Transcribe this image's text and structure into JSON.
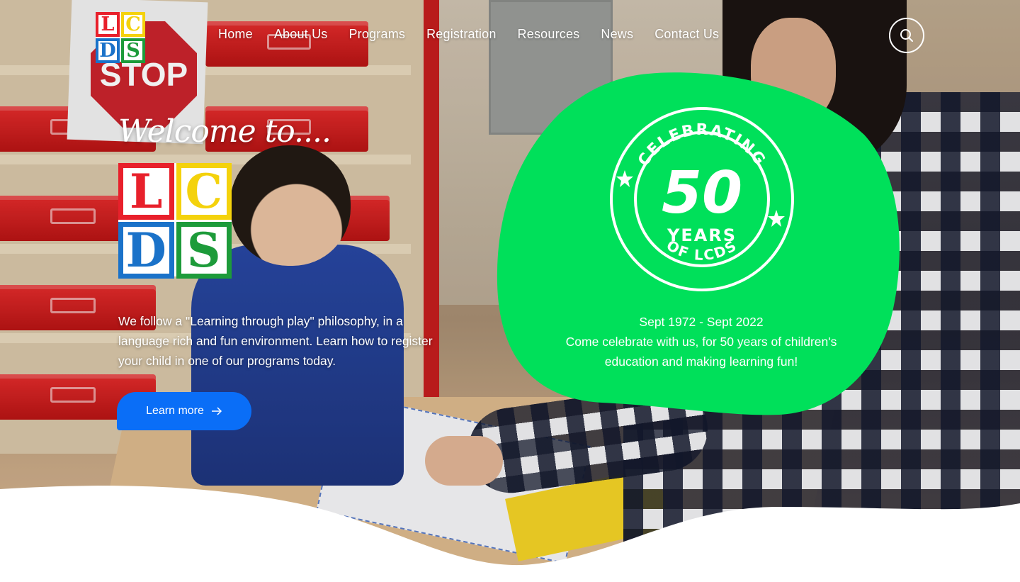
{
  "site": {
    "logo_letters": [
      "L",
      "C",
      "D",
      "S"
    ],
    "brand_colors": {
      "l": "#e8202b",
      "c": "#f4d20c",
      "d": "#1a72c9",
      "s": "#1d9b3a"
    }
  },
  "nav": {
    "items": [
      {
        "label": "Home"
      },
      {
        "label": "About Us"
      },
      {
        "label": "Programs"
      },
      {
        "label": "Registration"
      },
      {
        "label": "Resources"
      },
      {
        "label": "News"
      },
      {
        "label": "Contact Us"
      }
    ],
    "search_icon": "search-icon"
  },
  "hero": {
    "welcome": "Welcome to....",
    "tagline": "We follow a \"Learning through play\" philosophy, in a language rich and fun environment. Learn how to register your child in one of our programs today.",
    "cta_label": "Learn more",
    "cta_icon": "arrow-right-icon",
    "cta_color": "#0a6ef7"
  },
  "anniversary": {
    "badge_top": "CELEBRATING",
    "badge_number": "50",
    "badge_middle": "YEARS",
    "badge_bottom": "OF LCDS",
    "dates": "Sept 1972 - Sept 2022",
    "message": "Come celebrate with us, for 50 years of children's education and making learning fun!",
    "blob_color": "#00e05a"
  }
}
